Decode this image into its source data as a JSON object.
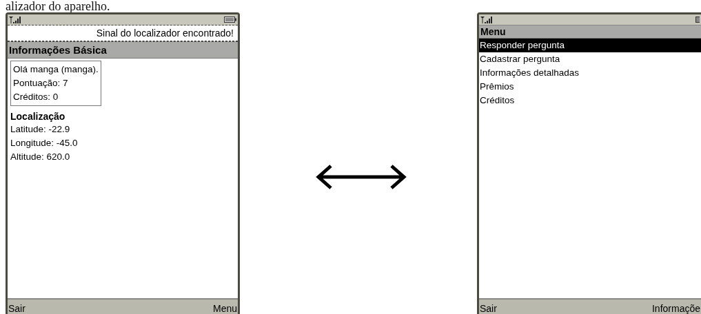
{
  "caption": "alizador do aparelho.",
  "left_phone": {
    "ticker": "Sinal do localizador encontrado!",
    "title": "Informações Básica",
    "user_box": [
      "Olá manga (manga).",
      "Pontuação: 7",
      "Créditos: 0"
    ],
    "section_heading": "Localização",
    "lines": [
      "Latitude: -22.9",
      "Longitude: -45.0",
      "Altitude: 620.0"
    ],
    "soft_keys": {
      "left": "Sair",
      "right": "Menu"
    }
  },
  "right_phone": {
    "title": "Menu",
    "menu_items": [
      {
        "label": "Responder pergunta",
        "selected": true
      },
      {
        "label": "Cadastrar pergunta",
        "selected": false
      },
      {
        "label": "Informações detalhadas",
        "selected": false
      },
      {
        "label": "Prêmios",
        "selected": false
      },
      {
        "label": "Créditos",
        "selected": false
      }
    ],
    "soft_keys": {
      "left": "Sair",
      "right": "Informaçõe"
    }
  }
}
